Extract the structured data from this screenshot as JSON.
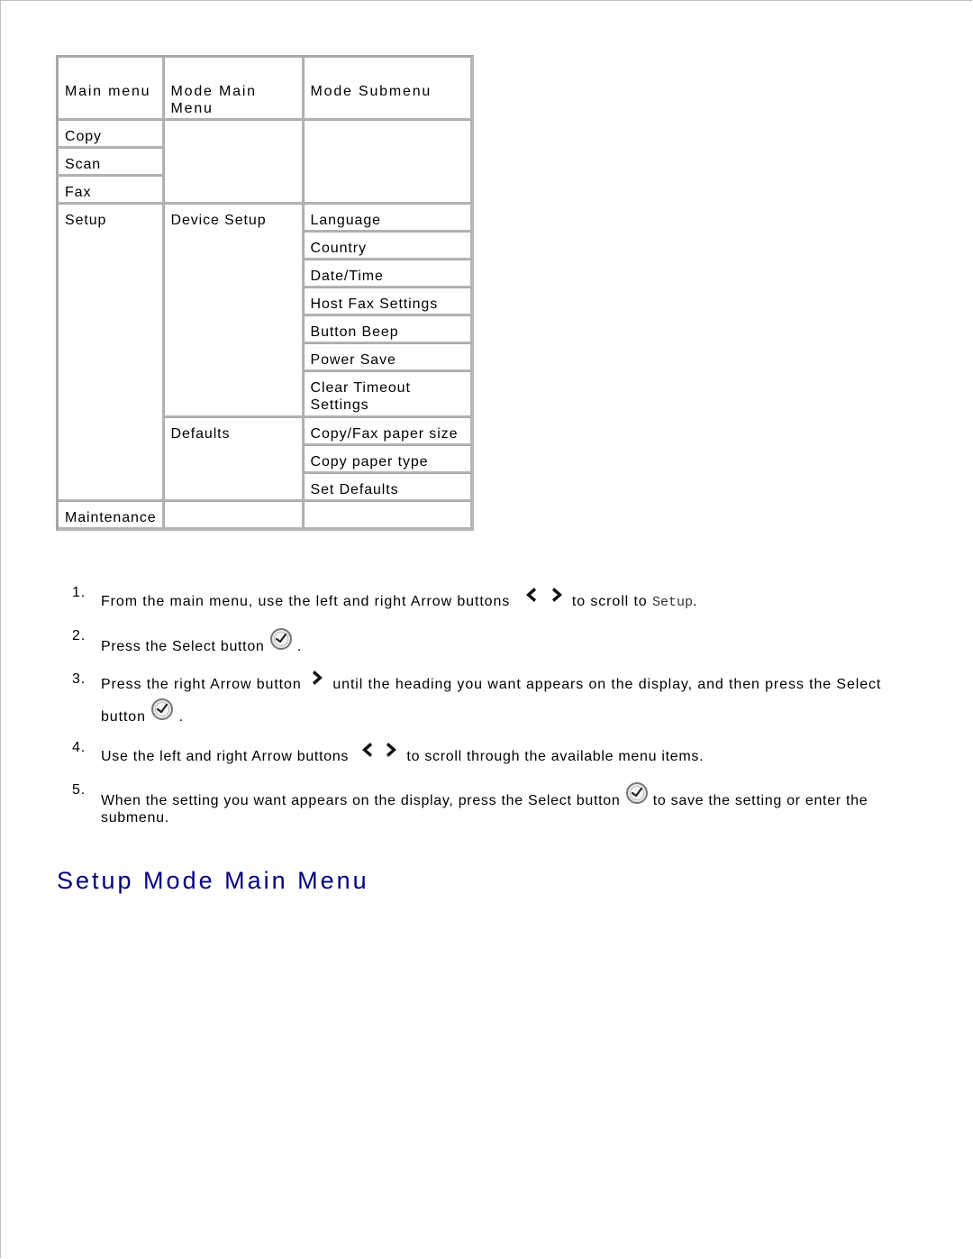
{
  "table": {
    "headers": [
      "Main menu",
      "Mode Main Menu",
      "Mode Submenu"
    ],
    "main_menu_items": [
      "Copy",
      "Scan",
      "Fax",
      "Setup",
      "Maintenance"
    ],
    "setup": {
      "device_setup": {
        "label": "Device Setup",
        "submenu": [
          "Language",
          "Country",
          "Date/Time",
          "Host Fax Settings",
          "Button Beep",
          "Power Save",
          "Clear Timeout Settings"
        ]
      },
      "defaults": {
        "label": "Defaults",
        "submenu": [
          "Copy/Fax paper size",
          "Copy paper type",
          "Set Defaults"
        ]
      }
    }
  },
  "steps": [
    {
      "number": "1.",
      "before": "From the main menu, use the left and right Arrow buttons",
      "icons": [
        "arrow-left-icon",
        "arrow-right-icon"
      ],
      "after": " to scroll to ",
      "code": "Setup",
      "end": "."
    },
    {
      "number": "2.",
      "before": "Press the Select button",
      "icons": [
        "select-button-icon"
      ],
      "after": "."
    },
    {
      "number": "3.",
      "before": "Press the right Arrow button",
      "icons": [
        "arrow-right-icon"
      ],
      "middle": " until the heading you want appears on the display, and then press the Select button",
      "icons2": [
        "select-button-icon"
      ],
      "after": "."
    },
    {
      "number": "4.",
      "before": "Use the left and right Arrow buttons",
      "icons": [
        "arrow-left-icon",
        "arrow-right-icon"
      ],
      "after": " to scroll through the available menu items."
    },
    {
      "number": "5.",
      "before": "When the setting you want appears on the display, press the Select button",
      "icons": [
        "select-button-icon"
      ],
      "after": " to save the setting or enter the submenu."
    }
  ],
  "heading": "Setup Mode Main Menu",
  "colors": {
    "heading": "#000080",
    "table_border": "#a8a8a8"
  }
}
